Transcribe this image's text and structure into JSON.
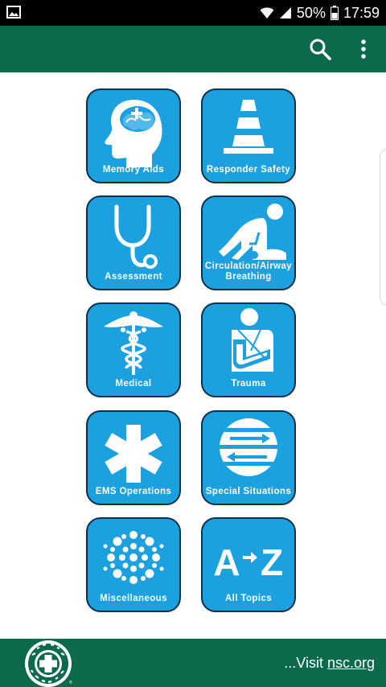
{
  "status_bar": {
    "battery": "50%",
    "time": "17:59",
    "icons": [
      "image-icon",
      "wifi-icon",
      "signal-icon",
      "battery-icon"
    ]
  },
  "app_bar": {
    "background": "#0a6a4b",
    "actions": [
      "search-icon",
      "more-vert-icon"
    ]
  },
  "tiles": [
    {
      "label": "Memory Aids",
      "icon": "brain-head-icon"
    },
    {
      "label": "Responder Safety",
      "icon": "traffic-cone-icon"
    },
    {
      "label": "Assessment",
      "icon": "stethoscope-icon"
    },
    {
      "label": "Circulation/Airway Breathing",
      "icon": "cpr-icon"
    },
    {
      "label": "Medical",
      "icon": "caduceus-icon"
    },
    {
      "label": "Trauma",
      "icon": "arm-sling-icon"
    },
    {
      "label": "EMS Operations",
      "icon": "star-of-life-icon"
    },
    {
      "label": "Special Situations",
      "icon": "arrows-circle-icon"
    },
    {
      "label": "Miscellaneous",
      "icon": "dots-circle-icon"
    },
    {
      "label": "All Topics",
      "icon": "a-to-z-icon"
    }
  ],
  "a_to_z_text": {
    "a": "A",
    "z": "Z"
  },
  "tile_color": "#1ba0e0",
  "footer": {
    "logo_ring_text": "NATIONAL SAFETY COUNCIL",
    "visit_prefix": "...Visit ",
    "visit_link": "nsc.org"
  }
}
